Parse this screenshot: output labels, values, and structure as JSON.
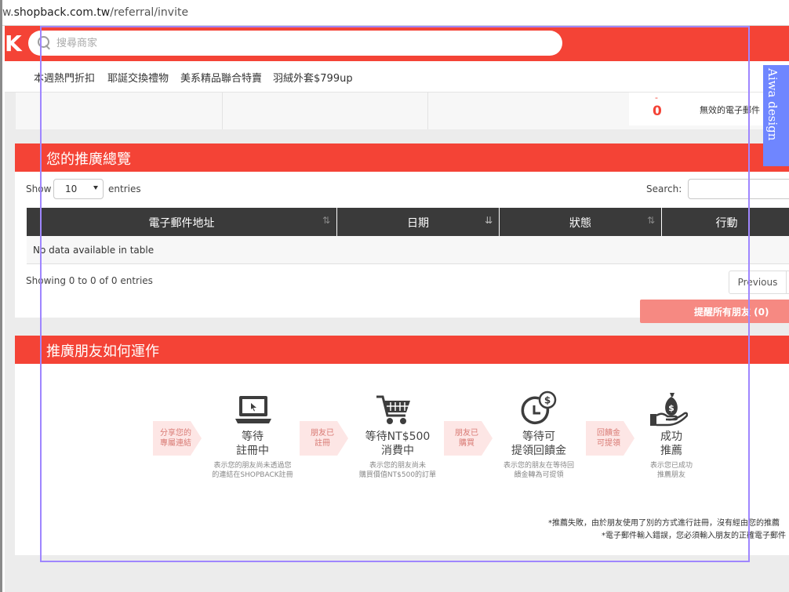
{
  "browser": {
    "url_prefix": "w.",
    "url_domain": "shopback.com.tw",
    "url_path": "/referral/invite"
  },
  "header": {
    "logo_text": "K",
    "search_placeholder": "搜尋商家",
    "brand_color": "#f44336"
  },
  "nav": {
    "items": [
      "本週熱門折扣",
      "耶誕交換禮物",
      "美系精品聯合特賣",
      "羽絨外套$799up"
    ]
  },
  "stats": {
    "invalid_count": "0",
    "invalid_label": "無效的電子郵件",
    "top_tick": "-"
  },
  "overview": {
    "title": "您的推廣總覽",
    "show_label": "Show",
    "page_length": "10",
    "entries_label": "entries",
    "search_label": "Search:",
    "columns": [
      "電子郵件地址",
      "日期",
      "狀態",
      "行動"
    ],
    "empty_message": "No data available in table",
    "info_text": "Showing 0 to 0 of 0 entries",
    "previous_label": "Previous",
    "remind_label": "提醒所有朋友 (0)"
  },
  "how": {
    "title": "推廣朋友如何運作",
    "arrows": [
      {
        "line1": "分享您的",
        "line2": "專屬連結"
      },
      {
        "line1": "朋友已",
        "line2": "註冊"
      },
      {
        "line1": "朋友已",
        "line2": "購買"
      },
      {
        "line1": "回饋金",
        "line2": "可提領"
      }
    ],
    "steps": [
      {
        "title1": "等待",
        "title2": "註冊中",
        "desc1": "表示您的朋友尚未透過您",
        "desc2": "的連結在SHOPBACK註冊",
        "icon": "laptop-icon"
      },
      {
        "title1": "等待NT$500",
        "title2": "消費中",
        "desc1": "表示您的朋友尚未",
        "desc2": "購買價值NT$500的訂單",
        "icon": "shopping-cart-icon"
      },
      {
        "title1": "等待可",
        "title2": "提領回饋金",
        "desc1": "表示您的朋友在等待回",
        "desc2": "饋金轉為可提領",
        "icon": "clock-money-icon"
      },
      {
        "title1": "成功",
        "title2": "推薦",
        "desc1": "表示您已成功",
        "desc2": "推薦朋友",
        "icon": "money-bag-hand-icon"
      }
    ],
    "note1": "*推薦失敗，由於朋友使用了別的方式進行註冊，沒有經由您的推薦",
    "note2": "*電子郵件輸入錯誤，您必須輸入朋友的正確電子郵件"
  },
  "watermark": {
    "text": "Aiwa design",
    "color": "#6f86ff"
  }
}
